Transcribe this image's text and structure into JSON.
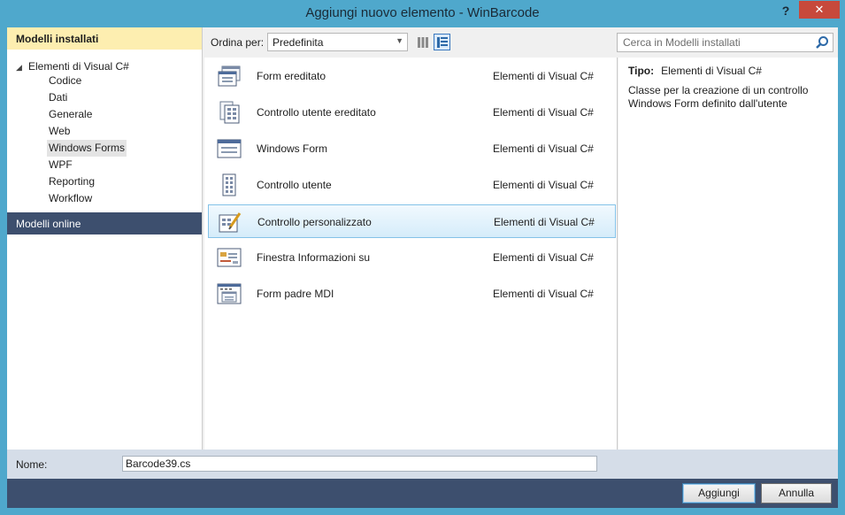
{
  "window": {
    "title": "Aggiungi nuovo elemento - WinBarcode",
    "help_label": "?",
    "close_label": "✕"
  },
  "left": {
    "header": "Modelli installati",
    "root": "Elementi di Visual C#",
    "items": [
      "Codice",
      "Dati",
      "Generale",
      "Web",
      "Windows Forms",
      "WPF",
      "Reporting",
      "Workflow"
    ],
    "selected": "Windows Forms",
    "online": "Modelli online"
  },
  "toolbar": {
    "sort_label": "Ordina per:",
    "sort_value": "Predefinita"
  },
  "search": {
    "placeholder": "Cerca in Modelli installati"
  },
  "templates": [
    {
      "name": "Form ereditato",
      "category": "Elementi di Visual C#",
      "icon": "inherited-form-icon"
    },
    {
      "name": "Controllo utente ereditato",
      "category": "Elementi di Visual C#",
      "icon": "inherited-user-control-icon"
    },
    {
      "name": "Windows Form",
      "category": "Elementi di Visual C#",
      "icon": "windows-form-icon"
    },
    {
      "name": "Controllo utente",
      "category": "Elementi di Visual C#",
      "icon": "user-control-icon"
    },
    {
      "name": "Controllo personalizzato",
      "category": "Elementi di Visual C#",
      "icon": "custom-control-icon"
    },
    {
      "name": "Finestra Informazioni su",
      "category": "Elementi di Visual C#",
      "icon": "about-box-icon"
    },
    {
      "name": "Form padre MDI",
      "category": "Elementi di Visual C#",
      "icon": "mdi-parent-form-icon"
    }
  ],
  "selected_template": "Controllo personalizzato",
  "details": {
    "type_label": "Tipo:",
    "type_value": "Elementi di Visual C#",
    "description": "Classe per la creazione di un controllo Windows Form definito dall'utente"
  },
  "bottom": {
    "name_label": "Nome:",
    "name_value": "Barcode39.cs",
    "add_label": "Aggiungi",
    "cancel_label": "Annulla"
  }
}
